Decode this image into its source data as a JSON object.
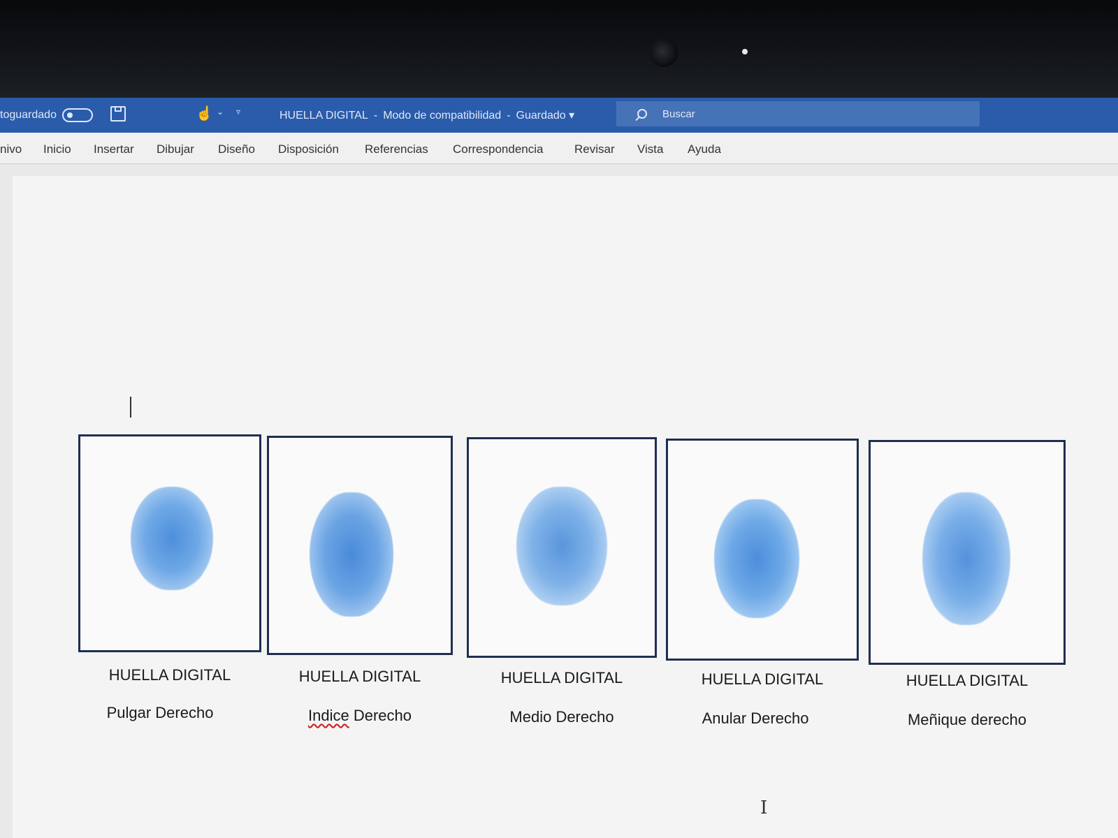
{
  "titlebar": {
    "autosave_label": "toguardado",
    "doc_name": "HUELLA DIGITAL",
    "mode": "Modo de compatibilidad",
    "status": "Guardado",
    "search_placeholder": "Buscar",
    "icons": [
      "save-icon",
      "touch-mode-icon",
      "customize-quick-access-icon",
      "search-icon"
    ]
  },
  "ribbon": {
    "tabs": [
      "nivo",
      "Inicio",
      "Insertar",
      "Dibujar",
      "Diseño",
      "Disposición",
      "Referencias",
      "Correspondencia",
      "Revisar",
      "Vista",
      "Ayuda"
    ]
  },
  "fingerprints": [
    {
      "title": "HUELLA DIGITAL",
      "finger": "Pulgar Derecho"
    },
    {
      "title": "HUELLA DIGITAL",
      "finger_word": "Indice",
      "finger_rest": " Derecho"
    },
    {
      "title": "HUELLA DIGITAL",
      "finger": "Medio Derecho"
    },
    {
      "title": "HUELLA DIGITAL",
      "finger": "Anular Derecho"
    },
    {
      "title": "HUELLA DIGITAL",
      "finger": "Meñique derecho"
    }
  ],
  "colors": {
    "titlebar": "#2a5cab",
    "ink": "#4a90d9",
    "box_border": "#1e2f4f"
  }
}
